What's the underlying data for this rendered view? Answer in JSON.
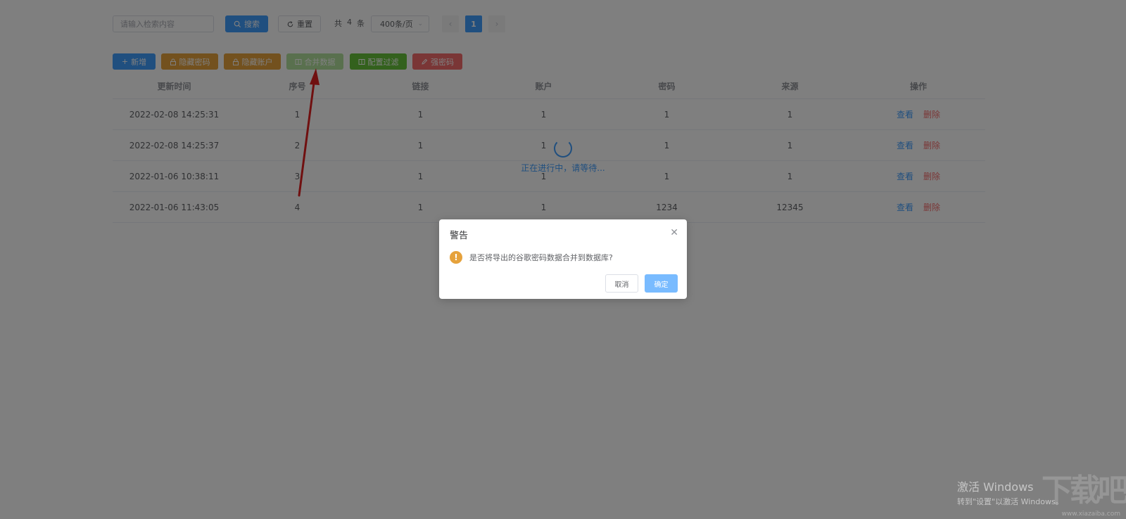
{
  "toolbar": {
    "search_placeholder": "请输入检索内容",
    "search_label": "搜索",
    "reset_label": "重置",
    "total_prefix": "共",
    "total_count": "4",
    "total_suffix": "条",
    "page_size": "400条/页",
    "current_page": "1"
  },
  "actions": {
    "add": "新增",
    "hide_password": "隐藏密码",
    "hide_account": "隐藏账户",
    "merge_data": "合并数据",
    "config_filter": "配置过滤",
    "strong_password": "强密码"
  },
  "table": {
    "headers": [
      "更新时间",
      "序号",
      "链接",
      "账户",
      "密码",
      "来源",
      "操作"
    ],
    "rows": [
      [
        "2022-02-08 14:25:31",
        "1",
        "1",
        "1",
        "1",
        "1"
      ],
      [
        "2022-02-08 14:25:37",
        "2",
        "1",
        "1",
        "1",
        "1"
      ],
      [
        "2022-01-06 10:38:11",
        "3",
        "1",
        "1",
        "1",
        "1"
      ],
      [
        "2022-01-06 11:43:05",
        "4",
        "1",
        "1",
        "1234",
        "12345"
      ]
    ],
    "op_view": "查看",
    "op_delete": "删除"
  },
  "loading": {
    "text": "正在进行中，请等待..."
  },
  "dialog": {
    "title": "警告",
    "message": "是否将导出的谷歌密码数据合并到数据库?",
    "cancel_label": "取消",
    "confirm_label": "确定"
  },
  "watermark": {
    "windows_title": "激活 Windows",
    "windows_sub": "转到\"设置\"以激活 Windows。",
    "site_logo": "下载吧",
    "site_url": "www.xiazaiba.com"
  },
  "colors": {
    "primary": "#409eff",
    "warning": "#e6a23c",
    "success": "#67c23a",
    "danger": "#f56c6c",
    "annotation_arrow": "#e02020"
  }
}
